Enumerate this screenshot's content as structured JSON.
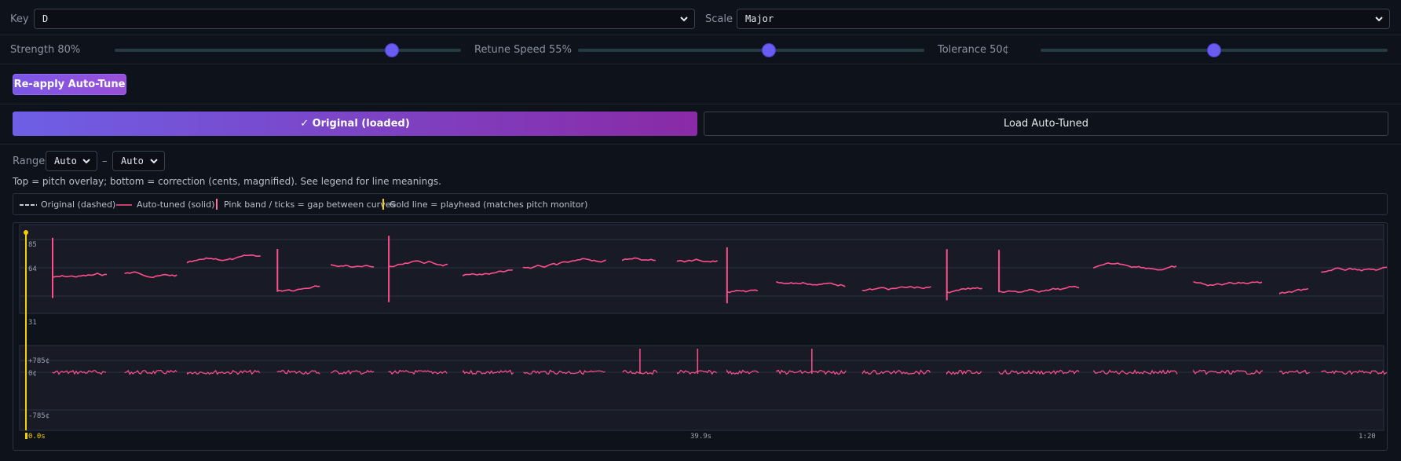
{
  "key": {
    "label": "Key",
    "value": "D"
  },
  "scale": {
    "label": "Scale",
    "value": "Major"
  },
  "sliders": [
    {
      "label": "Strength 80%",
      "value": 0.8
    },
    {
      "label": "Retune Speed 55%",
      "value": 0.55
    },
    {
      "label": "Tolerance 50¢",
      "value": 0.5
    }
  ],
  "reapply_label": "Re-apply Auto-Tune",
  "toggle": {
    "original_label": "✓ Original (loaded)",
    "load_label": "Load Auto-Tuned"
  },
  "range": {
    "label": "Range",
    "from": "Auto",
    "sep": "–",
    "to": "Auto"
  },
  "hint": "Top = pitch overlay; bottom = correction (cents, magnified). See legend for line meanings.",
  "legend": {
    "original": "Original (dashed)",
    "autotuned": "Auto-tuned (solid)",
    "gap": "Pink band / ticks = gap between curves",
    "playhead": "Gold line = playhead (matches pitch monitor)"
  },
  "colors": {
    "accent": "#6a5cf0",
    "pink": "#ff4f8b",
    "gold": "#f5d000",
    "original": "#c8ccd6"
  },
  "pitch_axis": {
    "top": "85",
    "mid": "64",
    "bottom": "31"
  },
  "cents_axis": {
    "top": "+785¢",
    "mid": "0¢",
    "bottom": "-785¢"
  },
  "time_axis": {
    "start": "0.0s",
    "mid": "39.9s",
    "end": "1:20"
  }
}
